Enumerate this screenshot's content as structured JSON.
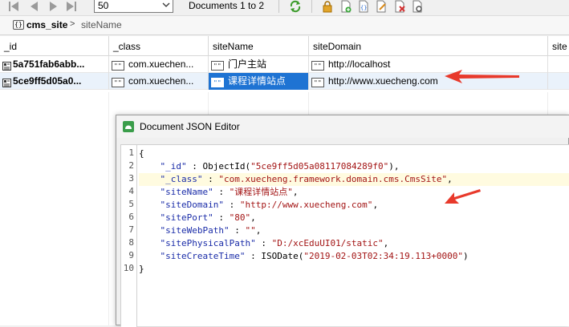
{
  "toolbar": {
    "page_size": "50",
    "documents_label": "Documents 1 to 2",
    "icons": [
      "first-page-icon",
      "previous-page-icon",
      "next-page-icon",
      "last-page-icon",
      "refresh-icon",
      "lock-icon",
      "add-document-icon",
      "view-json-icon",
      "edit-icon",
      "delete-icon",
      "settings-icon"
    ]
  },
  "breadcrumb": {
    "collection": "cms_site",
    "field": "siteName",
    "separator": ">"
  },
  "grid": {
    "columns": [
      "_id",
      "_class",
      "siteName",
      "siteDomain",
      "site"
    ],
    "rows": [
      {
        "_id": "5a751fab6abb...",
        "_class": "com.xuechen...",
        "siteName": "门户主站",
        "siteDomain": "http://localhost"
      },
      {
        "_id": "5ce9ff5d05a0...",
        "_class": "com.xuechen...",
        "siteName": "课程详情站点",
        "siteDomain": "http://www.xuecheng.com"
      }
    ]
  },
  "editor": {
    "title": "Document JSON Editor",
    "lines": [
      {
        "n": "1",
        "text": "{"
      },
      {
        "n": "2",
        "key": "\"_id\"",
        "sep": " : ",
        "fn": "ObjectId(",
        "val": "\"5ce9ff5d05a08117084289f0\"",
        "end": "),"
      },
      {
        "n": "3",
        "key": "\"_class\"",
        "sep": " : ",
        "fn": "",
        "val": "\"com.xuecheng.framework.domain.cms.CmsSite\"",
        "end": ","
      },
      {
        "n": "4",
        "key": "\"siteName\"",
        "sep": " : ",
        "fn": "",
        "val": "\"课程详情站点\"",
        "end": ","
      },
      {
        "n": "5",
        "key": "\"siteDomain\"",
        "sep": " : ",
        "fn": "",
        "val": "\"http://www.xuecheng.com\"",
        "end": ","
      },
      {
        "n": "6",
        "key": "\"sitePort\"",
        "sep": " : ",
        "fn": "",
        "val": "\"80\"",
        "end": ","
      },
      {
        "n": "7",
        "key": "\"siteWebPath\"",
        "sep": " : ",
        "fn": "",
        "val": "\"\"",
        "end": ","
      },
      {
        "n": "8",
        "key": "\"sitePhysicalPath\"",
        "sep": " : ",
        "fn": "",
        "val": "\"D:/xcEduUI01/static\"",
        "end": ","
      },
      {
        "n": "9",
        "key": "\"siteCreateTime\"",
        "sep": " : ",
        "fn": "ISODate(",
        "val": "\"2019-02-03T02:34:19.113+0000\"",
        "end": ")"
      },
      {
        "n": "10",
        "text": "}"
      }
    ]
  },
  "colors": {
    "selection": "#1e73d3",
    "annotation_arrow": "#e8392b",
    "json_key": "#1a2ca8",
    "json_string": "#a31515"
  }
}
